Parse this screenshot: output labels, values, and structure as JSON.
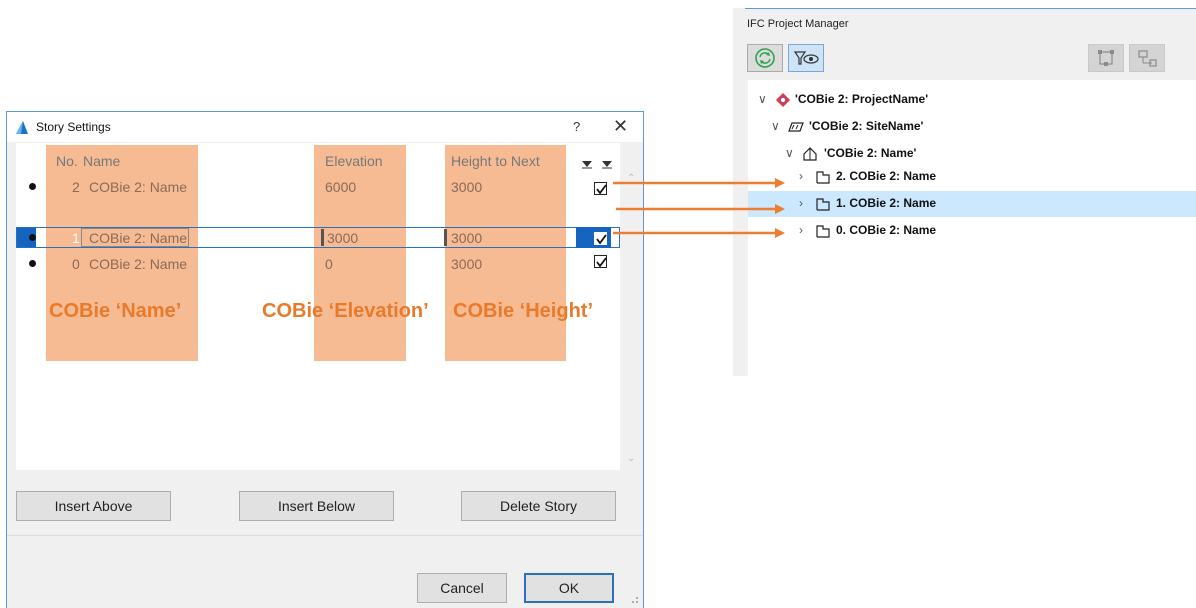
{
  "story_dialog": {
    "title": "Story Settings",
    "help": "?",
    "close": "✕",
    "columns": {
      "no": "No.",
      "name": "Name",
      "elevation": "Elevation",
      "height": "Height to Next"
    },
    "rows": [
      {
        "no": "2",
        "name": "COBie 2: Name",
        "elevation": "6000",
        "height": "3000",
        "visible": true
      },
      {
        "no": "1",
        "name": "COBie 2: Name",
        "elevation": "3000",
        "height": "3000",
        "visible": true,
        "selected": true
      },
      {
        "no": "0",
        "name": "COBie 2: Name",
        "elevation": "0",
        "height": "3000",
        "visible": true
      }
    ],
    "annotations": {
      "name": "COBie ‘Name’",
      "elevation": "COBie ‘Elevation’",
      "height": "COBie ‘Height’"
    },
    "buttons": {
      "insert_above": "Insert Above",
      "insert_below": "Insert Below",
      "delete_story": "Delete Story",
      "cancel": "Cancel",
      "ok": "OK"
    },
    "highlight_color": "#f7bb94",
    "annotation_color": "#e87b2b"
  },
  "ifc_manager": {
    "title": "IFC Project Manager",
    "toolbar": [
      "refresh-icon",
      "filter-view-icon",
      "structure-icon",
      "hierarchy-icon"
    ],
    "tree": [
      {
        "label": "'COBie 2: ProjectName'",
        "icon": "project-icon",
        "level": 0,
        "expand": "∨"
      },
      {
        "label": "'COBie 2: SiteName'",
        "icon": "site-icon",
        "level": 1,
        "expand": "∨"
      },
      {
        "label": "'COBie 2: Name'",
        "icon": "building-icon",
        "level": 2,
        "expand": "∨"
      },
      {
        "label": "2. COBie 2: Name",
        "icon": "storey-icon",
        "level": 3,
        "expand": "›"
      },
      {
        "label": "1. COBie 2: Name",
        "icon": "storey-icon",
        "level": 3,
        "expand": "›",
        "selected": true
      },
      {
        "label": "0. COBie 2: Name",
        "icon": "storey-icon",
        "level": 3,
        "expand": "›"
      }
    ]
  },
  "arrow_color": "#ed7d31"
}
